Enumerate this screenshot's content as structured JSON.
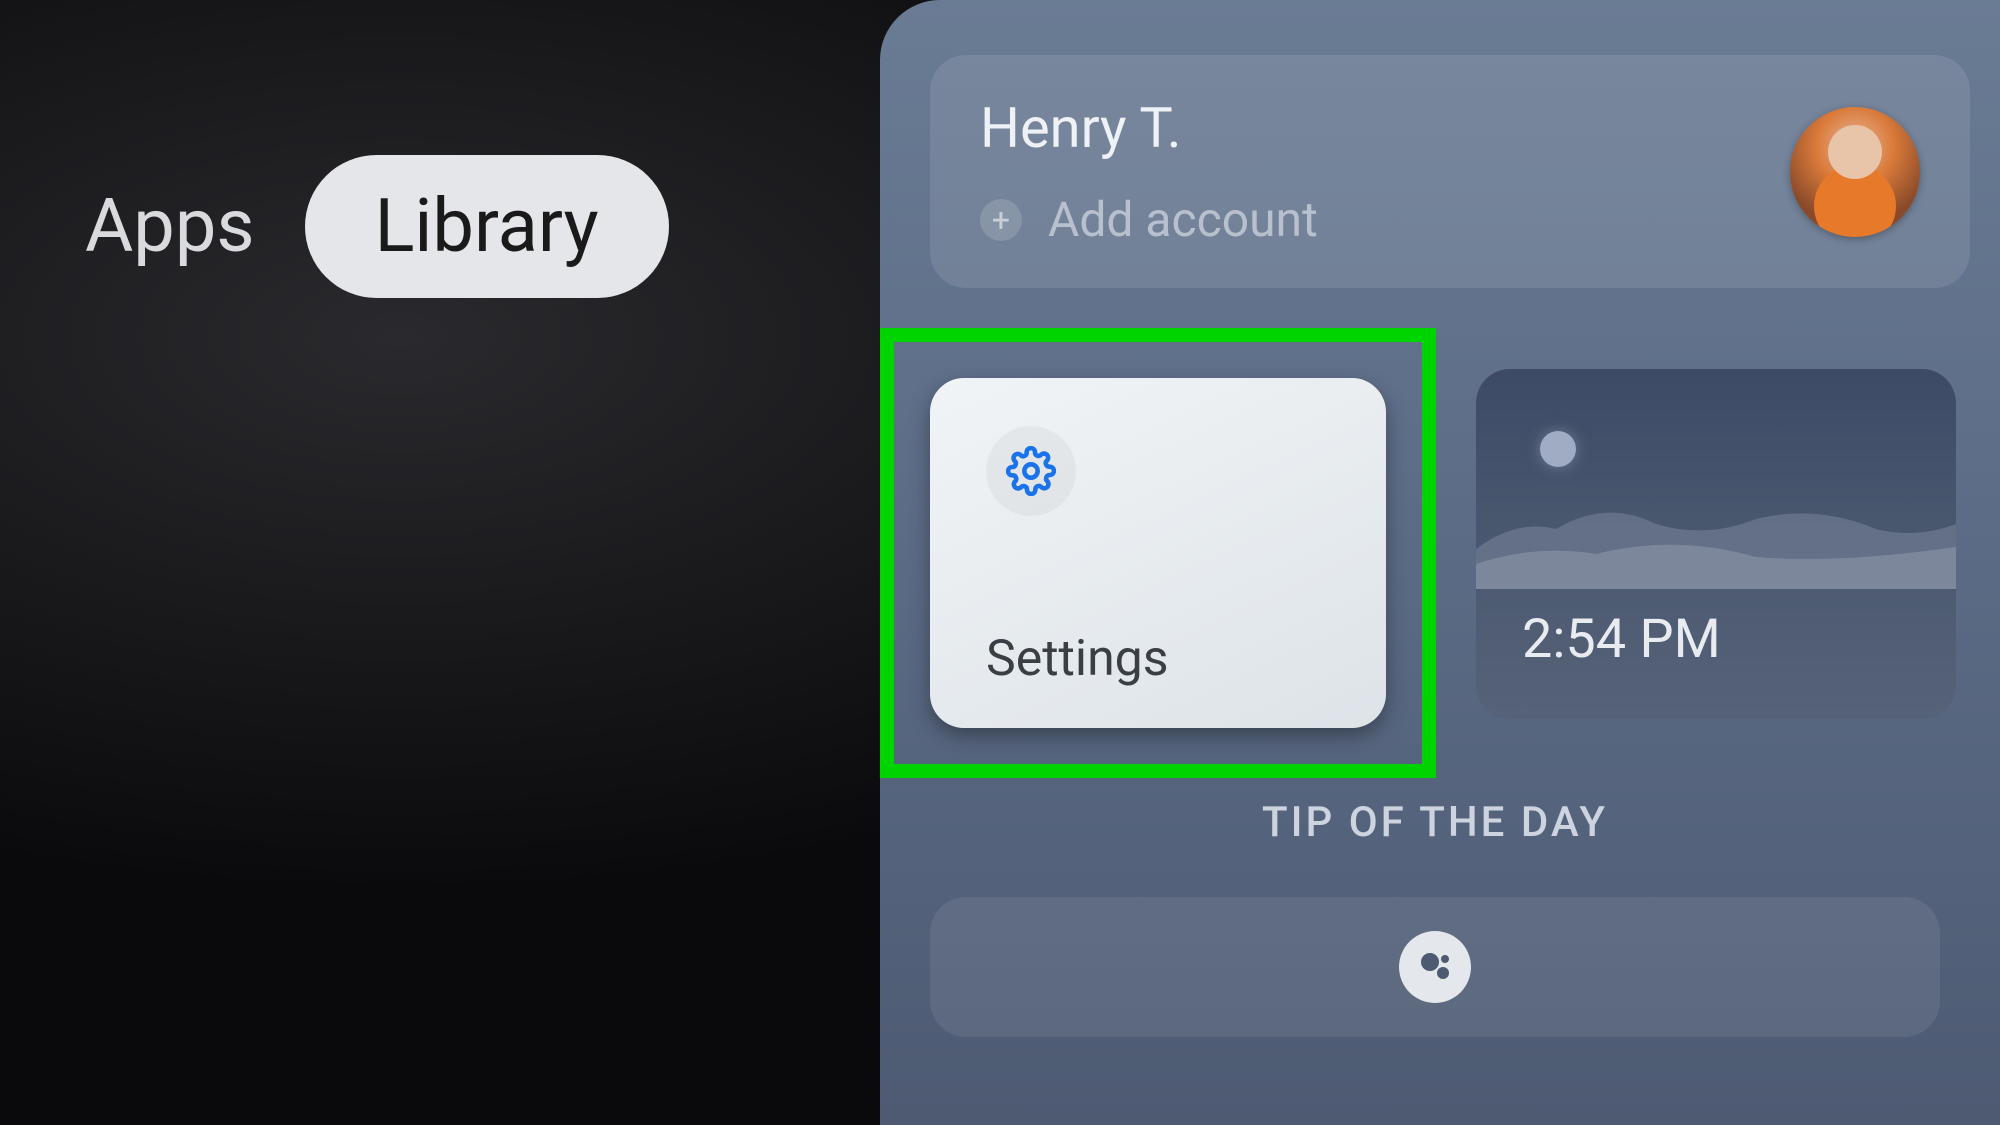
{
  "nav": {
    "tabs": [
      {
        "label": "Apps",
        "selected": false
      },
      {
        "label": "Library",
        "selected": true
      }
    ]
  },
  "panel": {
    "account": {
      "user_name": "Henry T.",
      "add_label": "Add account"
    },
    "tiles": {
      "settings": {
        "label": "Settings"
      },
      "weather": {
        "time": "2:54 PM"
      }
    },
    "tip_heading": "TIP OF THE DAY"
  }
}
